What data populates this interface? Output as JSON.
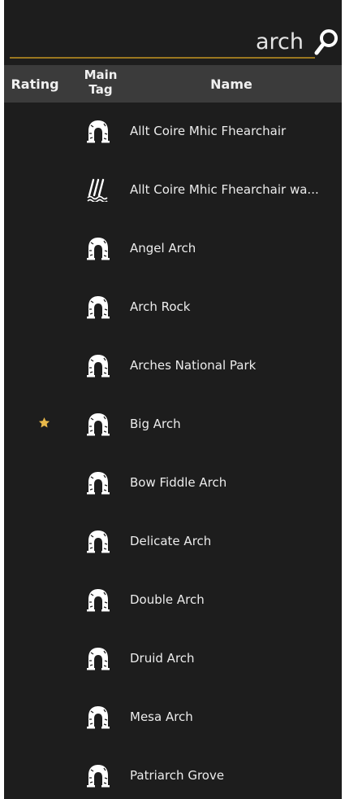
{
  "search": {
    "value": "arch",
    "button_icon": "search-icon"
  },
  "columns": {
    "rating": "Rating",
    "main_tag": "Main Tag",
    "name": "Name"
  },
  "colors": {
    "background": "#1d1d1d",
    "header": "#3b3b3b",
    "accent": "#9a7720",
    "star": "#e8b84a",
    "text": "#ececec"
  },
  "rows": [
    {
      "name": "Allt Coire Mhic Fhearchair",
      "icon": "arch-icon",
      "rating": 0
    },
    {
      "name": "Allt Coire Mhic Fhearchair wa...",
      "icon": "waterfall-icon",
      "rating": 0
    },
    {
      "name": "Angel Arch",
      "icon": "arch-icon",
      "rating": 0
    },
    {
      "name": "Arch Rock",
      "icon": "arch-icon",
      "rating": 0
    },
    {
      "name": "Arches National Park",
      "icon": "arch-icon",
      "rating": 0
    },
    {
      "name": "Big Arch",
      "icon": "arch-icon",
      "rating": 1
    },
    {
      "name": "Bow Fiddle Arch",
      "icon": "arch-icon",
      "rating": 0
    },
    {
      "name": "Delicate Arch",
      "icon": "arch-icon",
      "rating": 0
    },
    {
      "name": "Double Arch",
      "icon": "arch-icon",
      "rating": 0
    },
    {
      "name": "Druid Arch",
      "icon": "arch-icon",
      "rating": 0
    },
    {
      "name": "Mesa Arch",
      "icon": "arch-icon",
      "rating": 0
    },
    {
      "name": "Patriarch Grove",
      "icon": "arch-icon",
      "rating": 0
    }
  ]
}
